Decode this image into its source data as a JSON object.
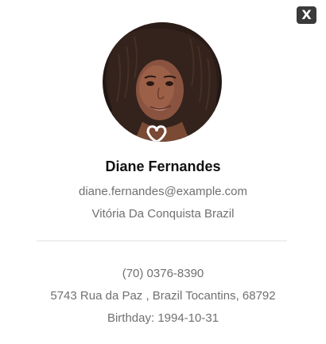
{
  "close_button": {
    "label": "X",
    "icon": "close-icon"
  },
  "profile": {
    "avatar_icon": "user-photo",
    "name": "Diane Fernandes",
    "email": "diane.fernandes@example.com",
    "location": "Vitória Da Conquista Brazil",
    "phone": "(70) 0376-8390",
    "address": "5743 Rua da Paz , Brazil Tocantins, 68792",
    "birthday": "Birthday: 1994-10-31"
  }
}
